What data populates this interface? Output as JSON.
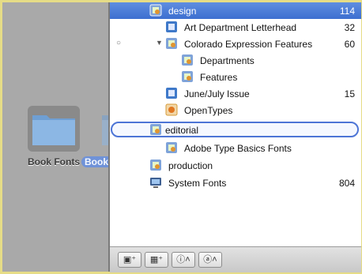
{
  "desktop": {
    "folder_label": "Book Fonts",
    "ghost_label": "Book Fonts"
  },
  "tree": {
    "items": [
      {
        "label": "design",
        "count": "114"
      },
      {
        "label": "Art Department Letterhead",
        "count": "32"
      },
      {
        "label": "Colorado Expression Features",
        "count": "60"
      },
      {
        "label": "Departments",
        "count": ""
      },
      {
        "label": "Features",
        "count": ""
      },
      {
        "label": "June/July Issue",
        "count": "15"
      },
      {
        "label": "OpenTypes",
        "count": ""
      },
      {
        "label": "editorial",
        "count": ""
      },
      {
        "label": "Adobe Type Basics Fonts",
        "count": ""
      },
      {
        "label": "production",
        "count": ""
      },
      {
        "label": "System Fonts",
        "count": "804"
      }
    ]
  },
  "toolbar": {
    "buttons": [
      {
        "icon": "new-set-icon",
        "glyph": "▣⁺"
      },
      {
        "icon": "new-library-icon",
        "glyph": "▦⁺"
      },
      {
        "icon": "info-icon",
        "glyph": "ⓘ˄"
      },
      {
        "icon": "font-action-icon",
        "glyph": "ⓐ˄"
      }
    ]
  },
  "colors": {
    "selection": "#3d6fd0",
    "frame": "#e6dc86",
    "panel": "#a9a9a9"
  }
}
